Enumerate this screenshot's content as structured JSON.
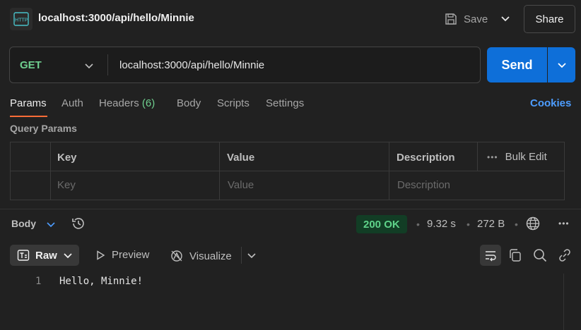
{
  "header": {
    "icon": "http-icon",
    "icon_text": "HTTP",
    "title": "localhost:3000/api/hello/Minnie",
    "save_label": "Save",
    "share_label": "Share"
  },
  "request": {
    "method": "GET",
    "url": "localhost:3000/api/hello/Minnie",
    "send_label": "Send"
  },
  "tabs": [
    {
      "label": "Params"
    },
    {
      "label": "Auth"
    },
    {
      "label": "Headers",
      "count": "(6)"
    },
    {
      "label": "Body"
    },
    {
      "label": "Scripts"
    },
    {
      "label": "Settings"
    }
  ],
  "cookies_label": "Cookies",
  "query_params": {
    "section_label": "Query Params",
    "columns": [
      "Key",
      "Value",
      "Description"
    ],
    "bulk_edit_label": "Bulk Edit",
    "placeholders": [
      "Key",
      "Value",
      "Description"
    ]
  },
  "response": {
    "body_label": "Body",
    "status": "200 OK",
    "time": "9.32 s",
    "size": "272 B",
    "raw_label": "Raw",
    "preview_label": "Preview",
    "visualize_label": "Visualize",
    "lines": [
      {
        "number": "1",
        "text": "Hello, Minnie!"
      }
    ]
  },
  "colors": {
    "accent": "#0e6fd9",
    "method_get": "#6fcf8f",
    "tab_underline": "#ff6c37",
    "cookies_link": "#4d9dff",
    "status_ok": "#5fd38a"
  }
}
